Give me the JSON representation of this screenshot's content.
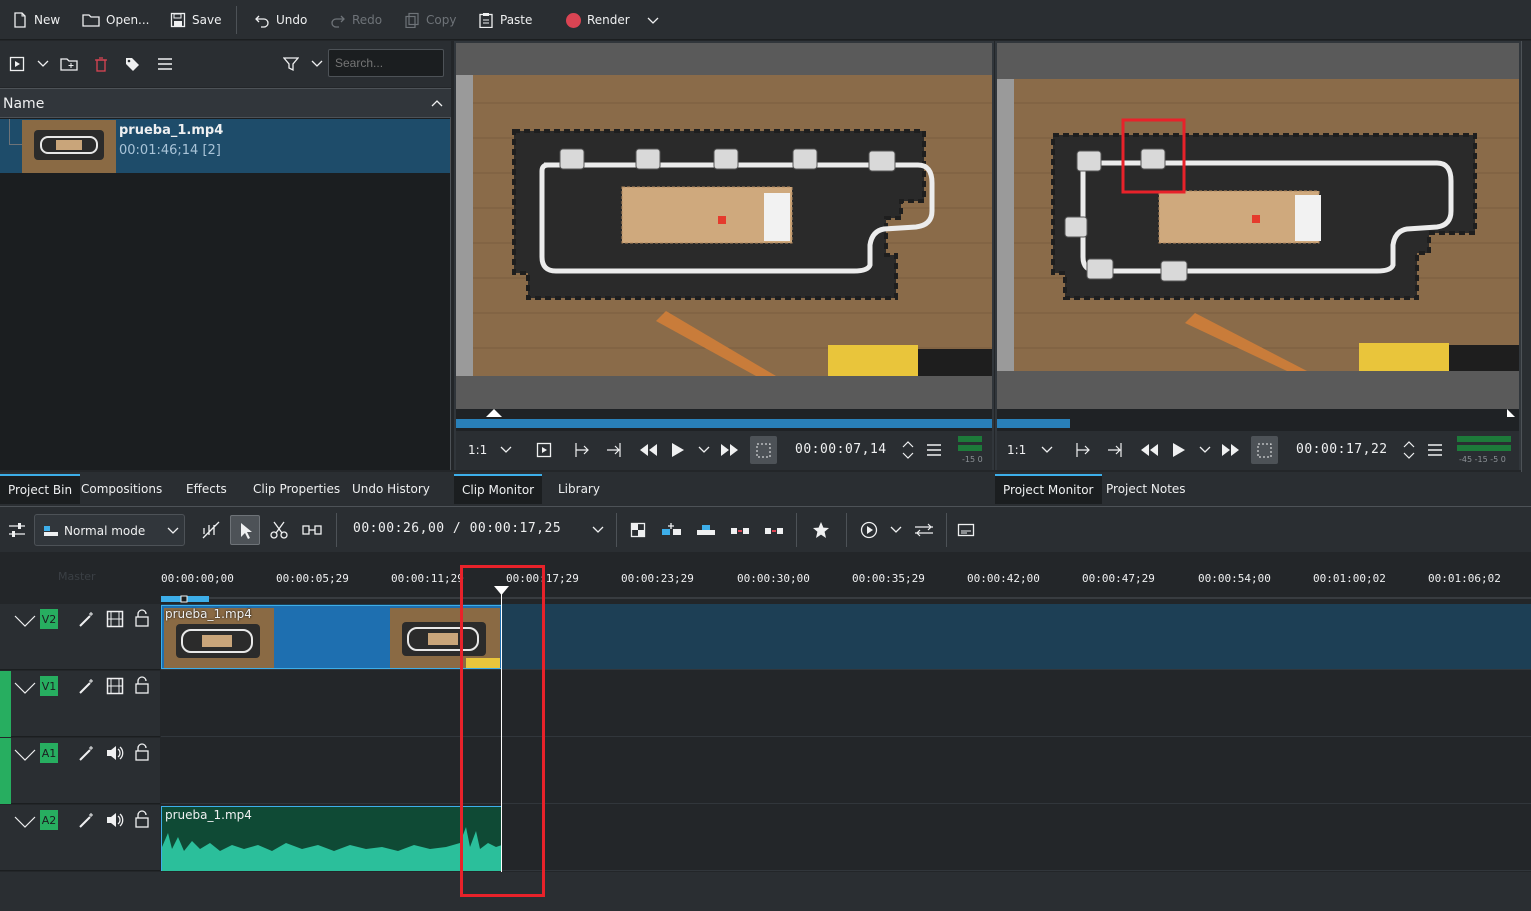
{
  "toolbar": {
    "new": "New",
    "open": "Open...",
    "save": "Save",
    "undo": "Undo",
    "redo": "Redo",
    "copy": "Copy",
    "paste": "Paste",
    "render": "Render"
  },
  "bin": {
    "search_placeholder": "Search...",
    "column_name": "Name",
    "clip": {
      "name": "prueba_1.mp4",
      "info": "00:01:46;14 [2]"
    }
  },
  "left_tabs": [
    "Project Bin",
    "Compositions",
    "Effects",
    "Clip Properties",
    "Undo History"
  ],
  "mid_tabs": [
    "Clip Monitor",
    "Library"
  ],
  "right_tabs": [
    "Project Monitor",
    "Project Notes"
  ],
  "clip_monitor": {
    "zoom": "1:1",
    "timecode": "00:00:07,14",
    "vu_label": "-15 0"
  },
  "project_monitor": {
    "zoom": "1:1",
    "timecode": "00:00:17,22",
    "vu_label": "-45 -15 -5 0"
  },
  "timeline": {
    "mode": "Normal mode",
    "position": "00:00:26,00 / 00:00:17,25",
    "master": "Master",
    "ticks": [
      "00:00:00;00",
      "00:00:05;29",
      "00:00:11;29",
      "00:00:17;29",
      "00:00:23;29",
      "00:00:30;00",
      "00:00:35;29",
      "00:00:42;00",
      "00:00:47;29",
      "00:00:54;00",
      "00:01:00;02",
      "00:01:06;02"
    ],
    "tracks": [
      {
        "tag": "V2",
        "type": "video"
      },
      {
        "tag": "V1",
        "type": "video"
      },
      {
        "tag": "A1",
        "type": "audio"
      },
      {
        "tag": "A2",
        "type": "audio"
      }
    ],
    "clip_v2": "prueba_1.mp4",
    "clip_a2": "prueba_1.mp4"
  }
}
